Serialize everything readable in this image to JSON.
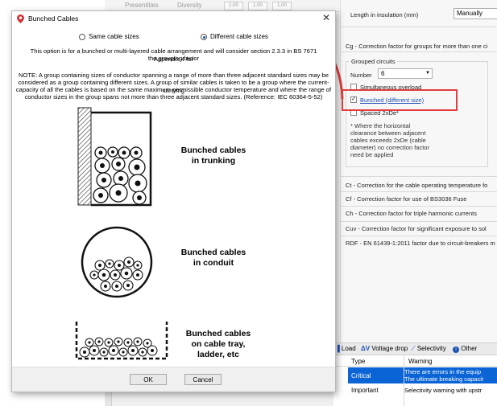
{
  "background": {
    "top_strip": {
      "presentities_label": "Presentities",
      "diversity_label": "Diversity",
      "input_values": [
        "1.00",
        "1.00",
        "1.00"
      ]
    },
    "right_panel": {
      "length_in_insulation_label": "Length in insulation (mm)",
      "length_mode_value": "Manually",
      "cg_label": "Cg - Correction factor for groups for more than one ci",
      "grouped_circuits_label": "Grouped circuits",
      "number_label": "Number",
      "number_value": "6",
      "simultaneous_label": "Simultaneous overload",
      "bunched_option_label": "Bunched (different size)",
      "spaced_label": "Spaced 2xDe*",
      "note": [
        "* Where the horizontal",
        "clearance between adjacent",
        "cables exceeds 2xDe (cable",
        "diameter) no correction factor",
        "need be applied"
      ],
      "ct_label": "Ct - Correction for the cable operating temperature fo",
      "cf_label": "Cf - Correction factor for use of BS3036 Fuse",
      "ch_label": "Ch - Correction factor for triple harmonic currents",
      "cuv_label": "Cuv - Correction factor for significant exposure to sol",
      "rdf_label": "RDF - EN 61439-1:2011 factor due to circuit-breakers m"
    },
    "tabs": [
      "Load",
      "Voltage drop",
      "Selectivity",
      "Other"
    ],
    "table": {
      "headers": [
        "Type",
        "Warning"
      ],
      "rows": [
        {
          "type": "Critical",
          "warning": [
            "There are errors in the equip",
            "The ultimate breaking capacit"
          ]
        },
        {
          "type": "Important",
          "warning": [
            "Selectivity warning with upstr"
          ]
        }
      ]
    }
  },
  "dialog": {
    "title": "Bunched Cables",
    "close_glyph": "✕",
    "radio_same": "Same cable sizes",
    "radio_different": "Different cable sizes",
    "selected": "different",
    "intro": [
      "This option is for a bunched or multi-layered cable arrangement and will consider section 2.3.3 in BS 7671 Appendix 4 for",
      "the grouping factor"
    ],
    "note": [
      "NOTE: A group containing sizes of conductor spanning a range of more than three adjacent standard sizes may be",
      "considered as a group containing different sizes. A group of similar cables is taken to be a group where the current-carrying",
      "capacity of all the cables is based on the same maximum permissible conductor temperature and where the range of",
      "conductor sizes in the group spans not more than three adjacent standard sizes. (Reference: IEC 60364-5-52)"
    ],
    "captions": {
      "trunking": [
        "Bunched cables",
        "in trunking"
      ],
      "conduit": [
        "Bunched cables",
        "in conduit"
      ],
      "tray": [
        "Bunched cables",
        "on cable tray,",
        "ladder, etc"
      ]
    },
    "ok_label": "OK",
    "cancel_label": "Cancel"
  },
  "colors": {
    "annotation_red": "#e43d3d",
    "accent_blue": "#1a4fb4",
    "critical_row": "#0a64d6"
  }
}
